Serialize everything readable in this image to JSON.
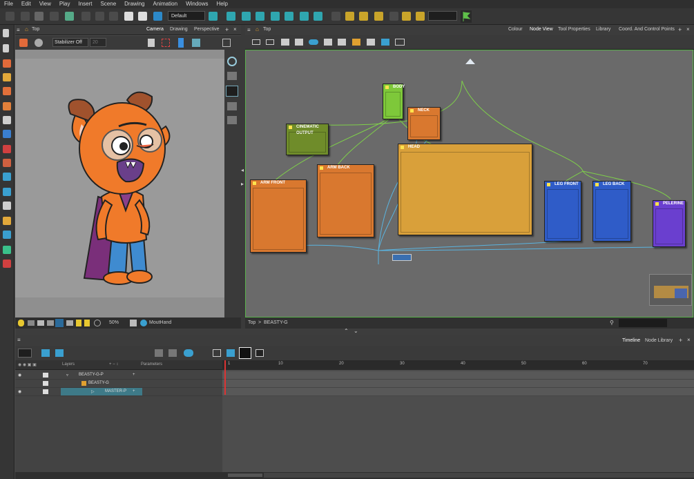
{
  "menu": [
    "File",
    "Edit",
    "View",
    "Play",
    "Insert",
    "Scene",
    "Drawing",
    "Animation",
    "Windows",
    "Help"
  ],
  "toolbar": {
    "preset": "Default"
  },
  "camera": {
    "home_label": "Top",
    "tabs": [
      "Camera",
      "Drawing",
      "Perspective"
    ],
    "stabilizer": "Stabilizer Off",
    "stabilizer_value": "20",
    "zoom": "50%",
    "drawing_name": "MoutHand"
  },
  "node_view": {
    "home_label": "Top",
    "tabs": [
      "Colour",
      "Node View",
      "Tool Properties",
      "Library",
      "Coord. And Control Points"
    ],
    "breadcrumb": [
      "Top",
      "BEASTY-G"
    ],
    "nodes": [
      {
        "id": "body",
        "title": "BODY",
        "color": "#7ec83a"
      },
      {
        "id": "neck",
        "title": "NECK",
        "color": "#d9782f"
      },
      {
        "id": "cinematic",
        "title": "CINEMATIC OUTPUT",
        "color": "#6f8c2a"
      },
      {
        "id": "head",
        "title": "HEAD",
        "color": "#d9a03a"
      },
      {
        "id": "arm_back",
        "title": "ARM BACK",
        "color": "#d9782f"
      },
      {
        "id": "arm_front",
        "title": "ARM FRONT",
        "color": "#d9782f"
      },
      {
        "id": "leg_front",
        "title": "LEG FRONT",
        "color": "#2f5cc8"
      },
      {
        "id": "leg_back",
        "title": "LEG BACK",
        "color": "#2f5cc8"
      },
      {
        "id": "pelerine",
        "title": "PELERINE",
        "color": "#6a3fcf"
      }
    ]
  },
  "timeline": {
    "tabs": [
      "Timeline",
      "Node Library"
    ],
    "columns": {
      "layers": "Layers",
      "parameters": "Parameters"
    },
    "layers": [
      {
        "name": "BEASTY-G-P"
      },
      {
        "name": "BEASTY-G"
      },
      {
        "name": "MASTER-P"
      }
    ],
    "ruler_ticks": [
      "1",
      "10",
      "20",
      "30",
      "40",
      "50",
      "60",
      "70"
    ]
  }
}
